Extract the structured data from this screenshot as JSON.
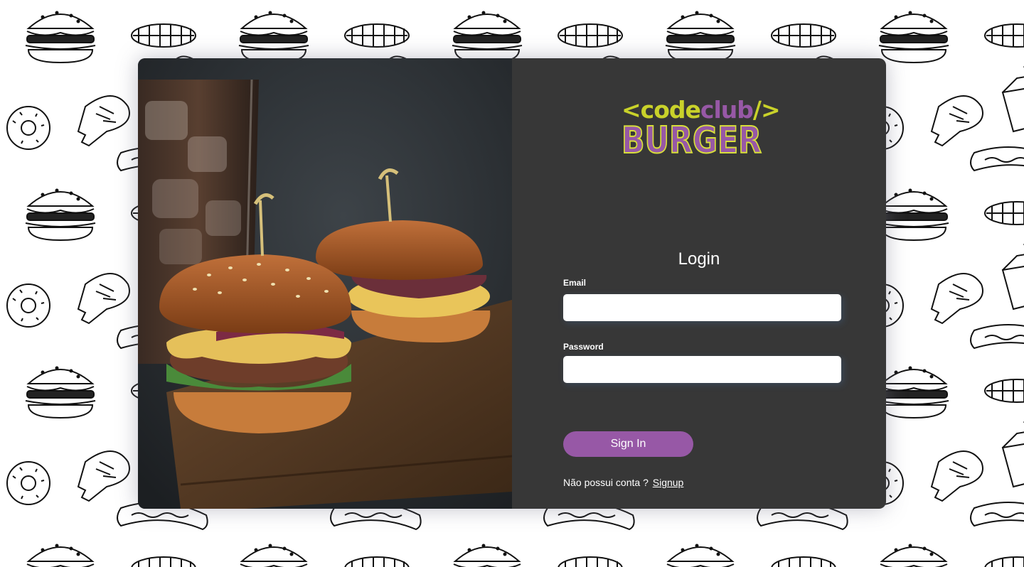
{
  "logo": {
    "line1_open": "<code",
    "line1_club": "club",
    "line1_close": "/>",
    "line2": "BURGER"
  },
  "login": {
    "title": "Login",
    "email_label": "Email",
    "email_value": "",
    "password_label": "Password",
    "password_value": "",
    "signin_label": "Sign In",
    "no_account_text": "Não possui conta ?",
    "signup_link": "Signup"
  },
  "colors": {
    "panel_bg": "#373737",
    "accent_purple": "#9758a6",
    "accent_yellow": "#c9d22a"
  }
}
